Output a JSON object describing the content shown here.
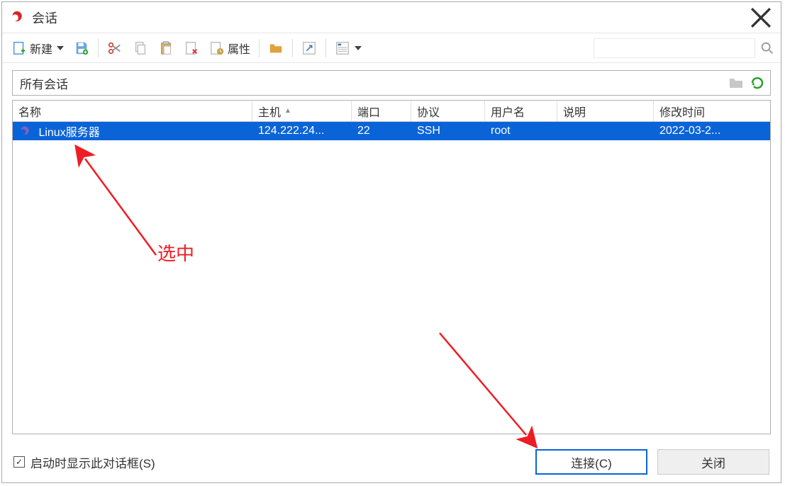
{
  "window": {
    "title": "会话"
  },
  "toolbar": {
    "new_label": "新建",
    "properties_label": "属性",
    "search_placeholder": ""
  },
  "breadcrumb": {
    "label": "所有会话"
  },
  "table": {
    "headers": {
      "name": "名称",
      "host": "主机",
      "port": "端口",
      "protocol": "协议",
      "user": "用户名",
      "description": "说明",
      "modified": "修改时间"
    },
    "rows": [
      {
        "name": "Linux服务器",
        "host": "124.222.24...",
        "port": "22",
        "protocol": "SSH",
        "user": "root",
        "description": "",
        "modified": "2022-03-2..."
      }
    ]
  },
  "footer": {
    "checkbox_label": "启动时显示此对话框(S)",
    "checkbox_checked": true,
    "connect_label": "连接(C)",
    "close_label": "关闭"
  },
  "annotation": {
    "select_label": "选中"
  }
}
